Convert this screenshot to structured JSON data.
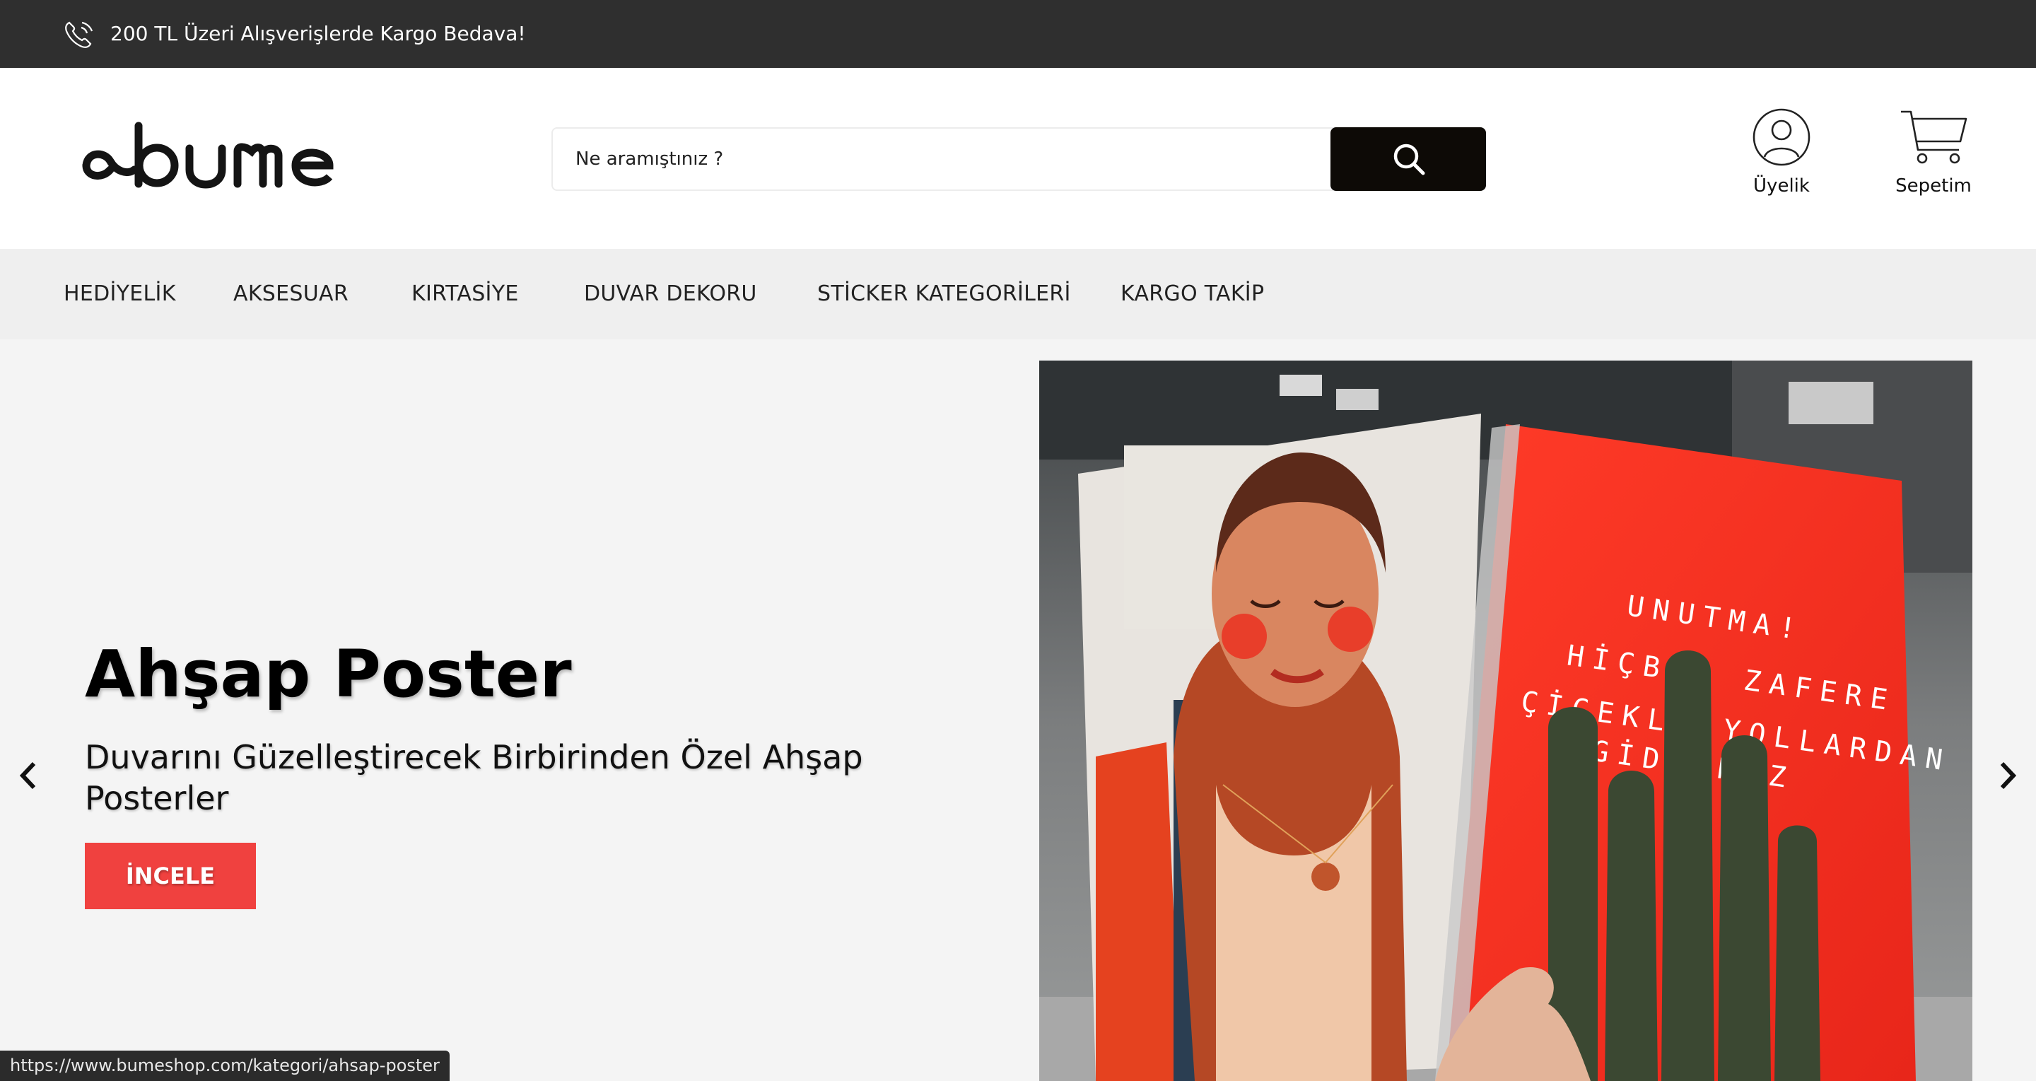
{
  "topbar": {
    "promo": "200 TL Üzeri Alışverişlerde Kargo Bedava!"
  },
  "header": {
    "search_placeholder": "Ne aramıştınız ?",
    "account_label": "Üyelik",
    "cart_label": "Sepetim"
  },
  "nav": {
    "items": [
      "HEDİYELİK",
      "AKSESUAR",
      "KIRTASİYE",
      "DUVAR DEKORU",
      "STİCKER KATEGORİLERİ",
      "KARGO TAKİP"
    ]
  },
  "hero": {
    "title": "Ahşap Poster",
    "subtitle": "Duvarını Güzelleştirecek Birbirinden Özel Ahşap Posterler",
    "cta": "İNCELE",
    "poster_lines": [
      "UNUTMA!",
      "HİÇBİR ZAFERE",
      "ÇİÇEKLİ YOLLARDAN",
      "GİDİLMEZ"
    ]
  },
  "status_bar": {
    "url": "https://www.bumeshop.com/kategori/ahsap-poster"
  },
  "colors": {
    "topbar": "#2f2f2f",
    "search_button": "#0d0a06",
    "cta": "#f0413f",
    "nav_bg": "#efefef",
    "hero_bg": "#f4f4f4"
  }
}
